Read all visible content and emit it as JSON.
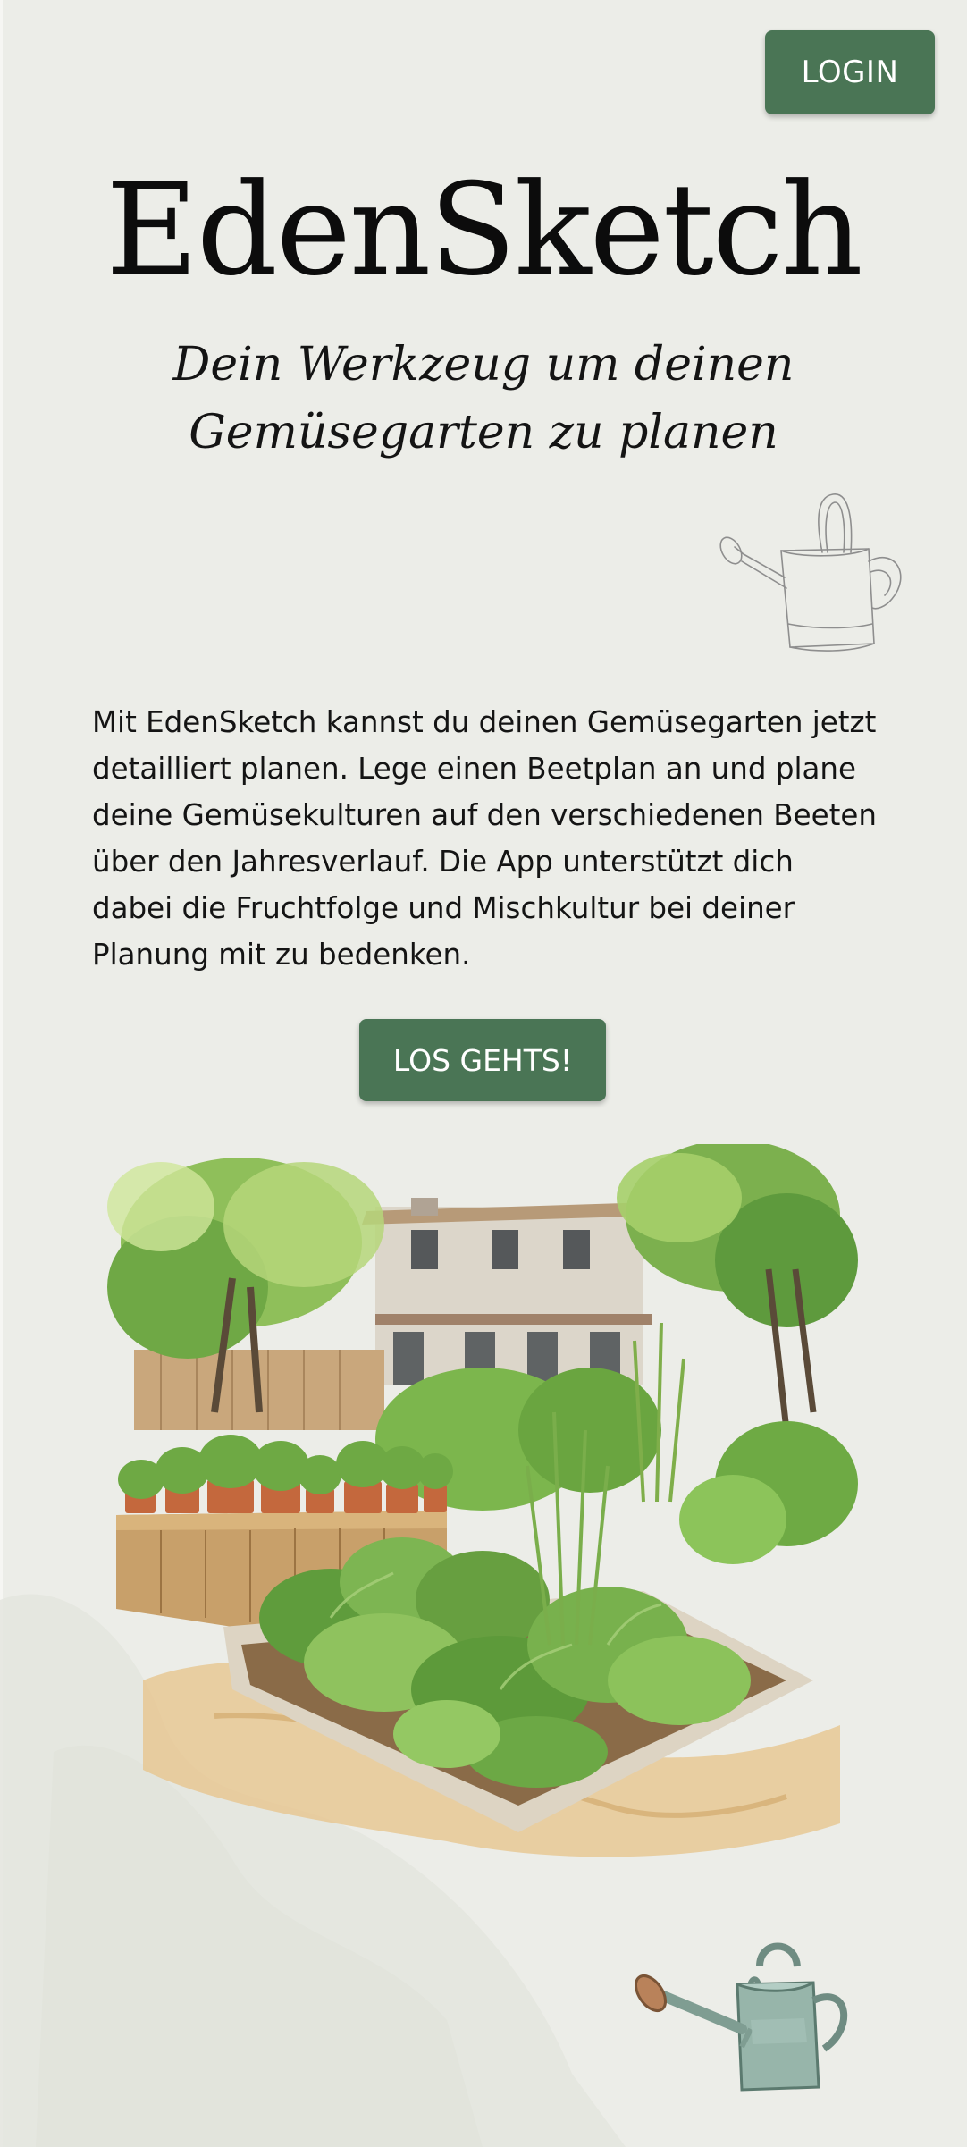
{
  "header": {
    "login_label": "LOGIN"
  },
  "hero": {
    "title": "EdenSketch",
    "tagline_line1": "Dein Werkzeug um deinen",
    "tagline_line2": "Gemüsegarten zu planen"
  },
  "main": {
    "description": "Mit EdenSketch kannst du deinen Gemüsegarten jetzt detailliert planen. Lege einen Beetplan an und plane deine Gemüsekulturen auf den verschiedenen Beeten über den Jahresverlauf. Die App unterstützt dich dabei die Fruchtfolge und Mischkultur bei deiner Planung mit zu bedenken.",
    "cta_label": "LOS GEHTS!"
  },
  "illustrations": {
    "top_icon": "watering-can-sketch-icon",
    "garden": "vegetable-garden-illustration",
    "bottom_icon": "watering-can-icon"
  },
  "colors": {
    "background": "#ecede8",
    "button": "#4a7555",
    "button_text": "#ffffff",
    "text": "#141414"
  }
}
